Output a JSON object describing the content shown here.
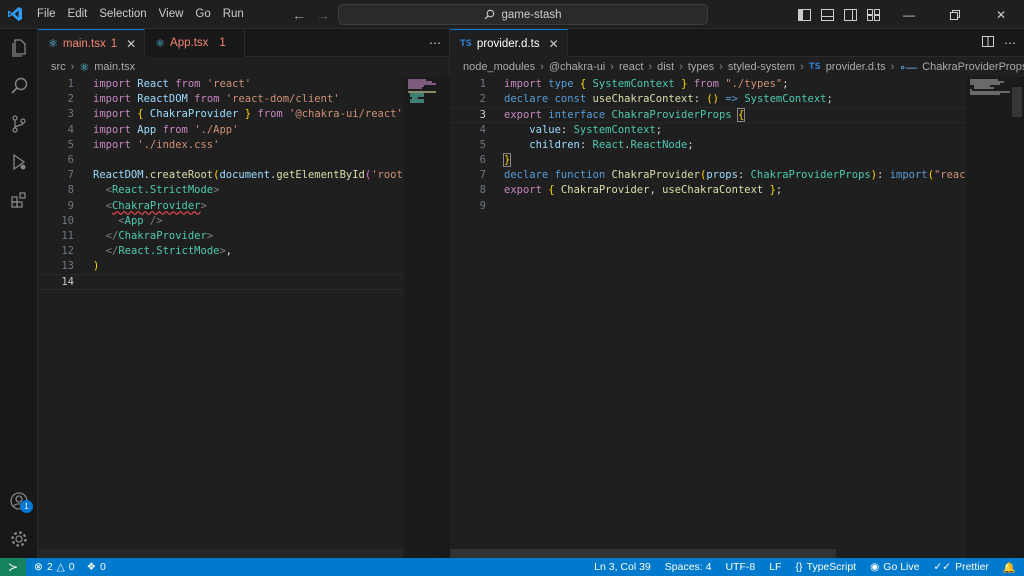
{
  "titlebar": {
    "menu": [
      "File",
      "Edit",
      "Selection",
      "View",
      "Go",
      "Run"
    ],
    "search_text": "game-stash"
  },
  "left_group": {
    "tabs": [
      {
        "name": "main.tsx",
        "errors": "1",
        "active": true
      },
      {
        "name": "App.tsx",
        "errors": "1",
        "active": false
      }
    ],
    "breadcrumb": [
      "src",
      "main.tsx"
    ],
    "line_numbers": [
      "1",
      "2",
      "3",
      "4",
      "5",
      "6",
      "7",
      "8",
      "9",
      "10",
      "11",
      "12",
      "13",
      "14"
    ],
    "current_line": "14"
  },
  "right_group": {
    "tab": {
      "name": "provider.d.ts",
      "icon": "TS"
    },
    "breadcrumb": [
      "node_modules",
      "@chakra-ui",
      "react",
      "dist",
      "types",
      "styled-system",
      "provider.d.ts",
      "ChakraProviderProps"
    ],
    "line_numbers": [
      "1",
      "2",
      "3",
      "4",
      "5",
      "6",
      "7",
      "8",
      "9"
    ],
    "current_line": "3"
  },
  "statusbar": {
    "errors": "2",
    "warnings": "0",
    "ports": "0",
    "position": "Ln 3, Col 39",
    "spaces": "Spaces: 4",
    "encoding": "UTF-8",
    "eol": "LF",
    "language": "TypeScript",
    "golive": "Go Live",
    "prettier": "Prettier"
  },
  "accounts_badge": "1",
  "colors": {
    "accent": "#0078d4",
    "statusbar": "#007acc",
    "remote": "#16825d"
  }
}
